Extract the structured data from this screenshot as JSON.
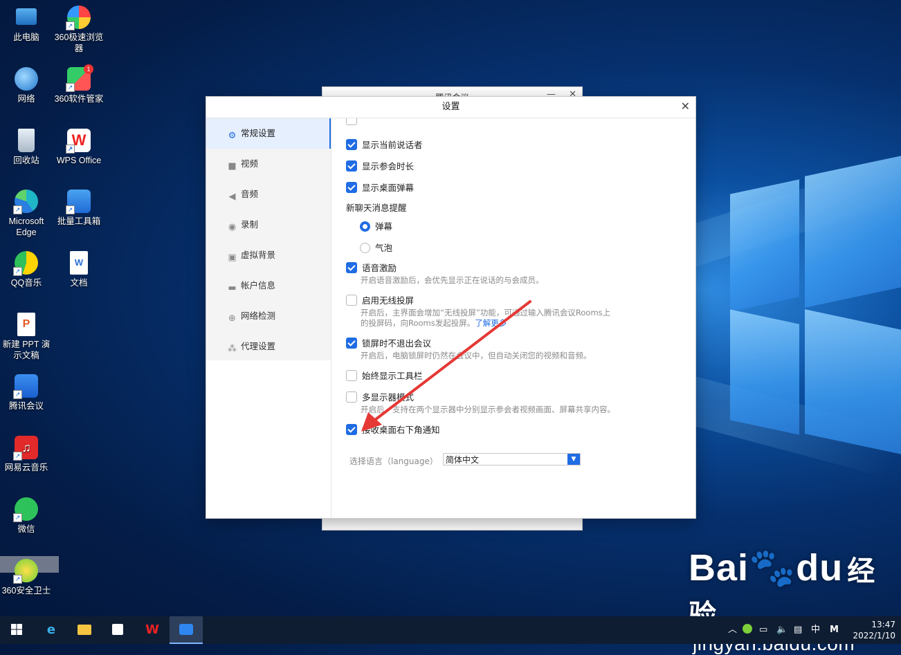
{
  "desktop": {
    "icons": [
      {
        "label": "此电脑",
        "icon": "computer-icon"
      },
      {
        "label": "360极速浏览器",
        "icon": "360-browser-icon"
      },
      {
        "label": "网络",
        "icon": "network-icon"
      },
      {
        "label": "360软件管家",
        "icon": "360-software-manager-icon",
        "badge": "1"
      },
      {
        "label": "回收站",
        "icon": "recycle-bin-icon"
      },
      {
        "label": "WPS Office",
        "icon": "wps-icon"
      },
      {
        "label": "Microsoft Edge",
        "icon": "edge-icon"
      },
      {
        "label": "批量工具箱",
        "icon": "toolbox-icon"
      },
      {
        "label": "QQ音乐",
        "icon": "qq-music-icon"
      },
      {
        "label": "文档",
        "icon": "document-icon"
      },
      {
        "label": "新建 PPT 演示文稿",
        "icon": "ppt-icon"
      },
      {
        "label": "腾讯会议",
        "icon": "tencent-meeting-icon"
      },
      {
        "label": "网易云音乐",
        "icon": "netease-music-icon"
      },
      {
        "label": "微信",
        "icon": "wechat-icon"
      },
      {
        "label": "360安全卫士",
        "icon": "360-security-icon"
      }
    ]
  },
  "background_window": {
    "title": "腾讯会议"
  },
  "settings": {
    "title": "设置",
    "nav": [
      {
        "label": "常规设置",
        "icon": "gear-icon",
        "active": true
      },
      {
        "label": "视频",
        "icon": "video-icon"
      },
      {
        "label": "音频",
        "icon": "speaker-icon"
      },
      {
        "label": "录制",
        "icon": "record-icon"
      },
      {
        "label": "虚拟背景",
        "icon": "virtual-background-icon"
      },
      {
        "label": "帐户信息",
        "icon": "account-card-icon"
      },
      {
        "label": "网络检测",
        "icon": "globe-icon"
      },
      {
        "label": "代理设置",
        "icon": "proxy-icon"
      }
    ],
    "options": {
      "show_speaker": {
        "label": "显示当前说话者",
        "checked": true
      },
      "show_duration": {
        "label": "显示参会时长",
        "checked": true
      },
      "show_danmaku": {
        "label": "显示桌面弹幕",
        "checked": true
      },
      "chat_section": "新聊天消息提醒",
      "chat_danmaku": {
        "label": "弹幕",
        "selected": true
      },
      "chat_bubble": {
        "label": "气泡",
        "selected": false
      },
      "voice_motivation": {
        "label": "语音激励",
        "checked": true,
        "desc": "开启语音激励后，会优先显示正在说话的与会成员。"
      },
      "wireless_cast": {
        "label": "启用无线投屏",
        "checked": false,
        "desc_line1": "开启后，主界面会增加“无线投屏”功能，可通过输入腾讯会议Rooms上",
        "desc_line2": "的投屏码，向Rooms发起投屏。",
        "link": "了解更多"
      },
      "lock_screen": {
        "label": "锁屏时不退出会议",
        "checked": true,
        "desc": "开启后，电脑锁屏时仍然在会议中，但自动关闭您的视频和音频。"
      },
      "always_toolbar": {
        "label": "始终显示工具栏",
        "checked": false
      },
      "multi_display": {
        "label": "多显示器模式",
        "checked": false,
        "desc": "开启后，支持在两个显示器中分别显示参会者视频画面、屏幕共享内容。"
      },
      "desktop_notify": {
        "label": "接收桌面右下角通知",
        "checked": true
      }
    },
    "language": {
      "label": "选择语言（language）",
      "value": "简体中文"
    }
  },
  "watermark": {
    "brand": "Bai",
    "brand2": "du",
    "suffix": "经验",
    "url": "jingyan.baidu.com"
  },
  "taskbar": {
    "ime_lang": "中",
    "ime_mode": "M",
    "time": "13:47",
    "date": "2022/1/10"
  },
  "colors": {
    "accent": "#1f6ce4",
    "annotation_arrow": "#e53935"
  }
}
